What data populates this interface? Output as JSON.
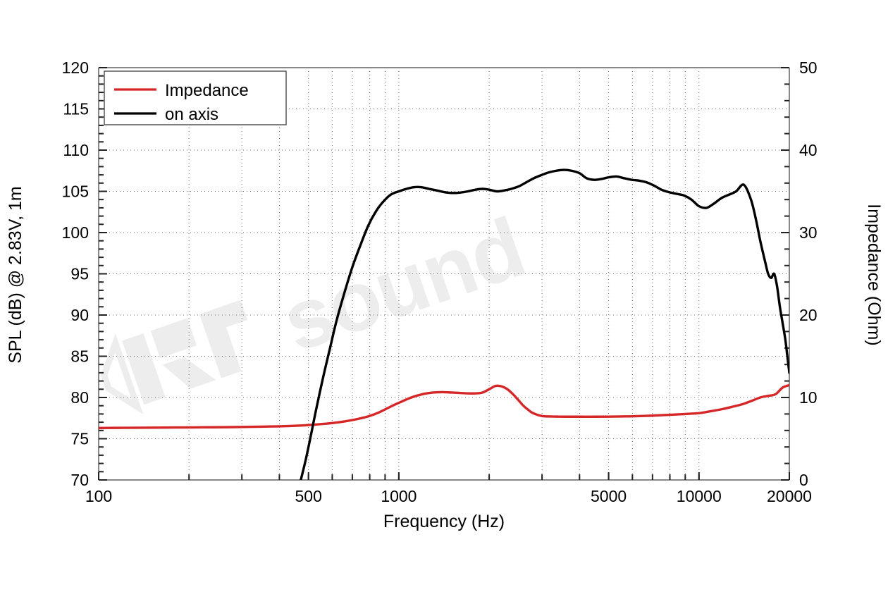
{
  "chart_data": {
    "type": "line",
    "title": "",
    "xlabel": "Frequency (Hz)",
    "ylabel": "SPL (dB) @ 2.83V, 1m",
    "y2label": "Impedance (Ohm)",
    "xscale": "log",
    "xlim": [
      100,
      20000
    ],
    "ylim": [
      70,
      120
    ],
    "y2lim": [
      0,
      50
    ],
    "xticks": [
      100,
      500,
      1000,
      5000,
      10000,
      20000
    ],
    "xticklabels": [
      "100",
      "500",
      "1000",
      "5000",
      "10000",
      "20000"
    ],
    "yticks": [
      70,
      75,
      80,
      85,
      90,
      95,
      100,
      105,
      110,
      115,
      120
    ],
    "yticklabels": [
      "70",
      "75",
      "80",
      "85",
      "90",
      "95",
      "100",
      "105",
      "110",
      "115",
      "120"
    ],
    "y2ticks": [
      0,
      10,
      20,
      30,
      40,
      50
    ],
    "y2ticklabels": [
      "0",
      "10",
      "20",
      "30",
      "40",
      "50"
    ],
    "grid": true,
    "grid_style": "dotted",
    "legend_position": "upper left",
    "series": [
      {
        "name": "Impedance",
        "color": "#d62728",
        "axis": "right",
        "unit": "Ohm",
        "x": [
          100,
          120,
          150,
          180,
          220,
          270,
          330,
          400,
          470,
          540,
          600,
          660,
          720,
          790,
          860,
          940,
          1000,
          1100,
          1200,
          1300,
          1400,
          1500,
          1600,
          1700,
          1800,
          1900,
          2000,
          2100,
          2200,
          2300,
          2400,
          2500,
          2600,
          2700,
          2800,
          3000,
          3200,
          3400,
          3600,
          3800,
          4000,
          4500,
          5000,
          5500,
          6000,
          7000,
          8000,
          9000,
          10000,
          11000,
          12000,
          13000,
          14000,
          15000,
          16000,
          17000,
          18000,
          19000,
          20000
        ],
        "y": [
          6.3,
          6.32,
          6.34,
          6.36,
          6.38,
          6.4,
          6.45,
          6.5,
          6.6,
          6.75,
          6.9,
          7.1,
          7.35,
          7.7,
          8.2,
          8.9,
          9.35,
          10.0,
          10.4,
          10.6,
          10.65,
          10.6,
          10.55,
          10.5,
          10.5,
          10.6,
          11.0,
          11.4,
          11.35,
          11.0,
          10.4,
          9.7,
          9.0,
          8.5,
          8.1,
          7.75,
          7.7,
          7.68,
          7.67,
          7.67,
          7.67,
          7.67,
          7.68,
          7.7,
          7.72,
          7.8,
          7.9,
          8.0,
          8.1,
          8.35,
          8.6,
          8.9,
          9.2,
          9.6,
          10.0,
          10.2,
          10.4,
          11.2,
          11.5
        ]
      },
      {
        "name": "on axis",
        "color": "#000000",
        "axis": "left",
        "unit": "dB",
        "x": [
          470,
          490,
          510,
          530,
          560,
          590,
          620,
          660,
          700,
          740,
          790,
          840,
          890,
          940,
          1000,
          1060,
          1120,
          1190,
          1260,
          1340,
          1420,
          1500,
          1600,
          1700,
          1800,
          1900,
          2000,
          2120,
          2240,
          2370,
          2510,
          2660,
          2820,
          3000,
          3160,
          3350,
          3550,
          3760,
          4000,
          4220,
          4470,
          4730,
          5010,
          5310,
          5620,
          5960,
          6310,
          6680,
          7080,
          7500,
          7940,
          8410,
          8910,
          9440,
          10000,
          10600,
          11200,
          11900,
          12600,
          13300,
          14100,
          14900,
          15500,
          16000,
          16600,
          17000,
          17400,
          17800,
          18200,
          18600,
          19000,
          19400,
          19700,
          20000
        ],
        "y": [
          69.8,
          72.5,
          75.5,
          78.5,
          82.5,
          86.0,
          89.3,
          92.8,
          95.8,
          98.2,
          100.8,
          102.6,
          103.8,
          104.6,
          105.0,
          105.3,
          105.5,
          105.5,
          105.3,
          105.1,
          104.9,
          104.8,
          104.85,
          105.0,
          105.2,
          105.3,
          105.2,
          105.0,
          105.1,
          105.3,
          105.6,
          106.1,
          106.6,
          107.0,
          107.3,
          107.5,
          107.6,
          107.5,
          107.2,
          106.6,
          106.4,
          106.5,
          106.7,
          106.8,
          106.6,
          106.4,
          106.3,
          106.1,
          105.7,
          105.2,
          104.9,
          104.7,
          104.5,
          104.0,
          103.2,
          103.0,
          103.5,
          104.2,
          104.6,
          105.0,
          105.8,
          104.0,
          101.5,
          99.0,
          96.5,
          95.0,
          94.5,
          95.0,
          93.5,
          91.0,
          89.0,
          87.0,
          85.0,
          83.0
        ]
      }
    ],
    "watermark": "sound"
  },
  "legend": {
    "entries": [
      {
        "label": "Impedance",
        "color": "#d62728"
      },
      {
        "label": "on axis",
        "color": "#000000"
      }
    ]
  }
}
